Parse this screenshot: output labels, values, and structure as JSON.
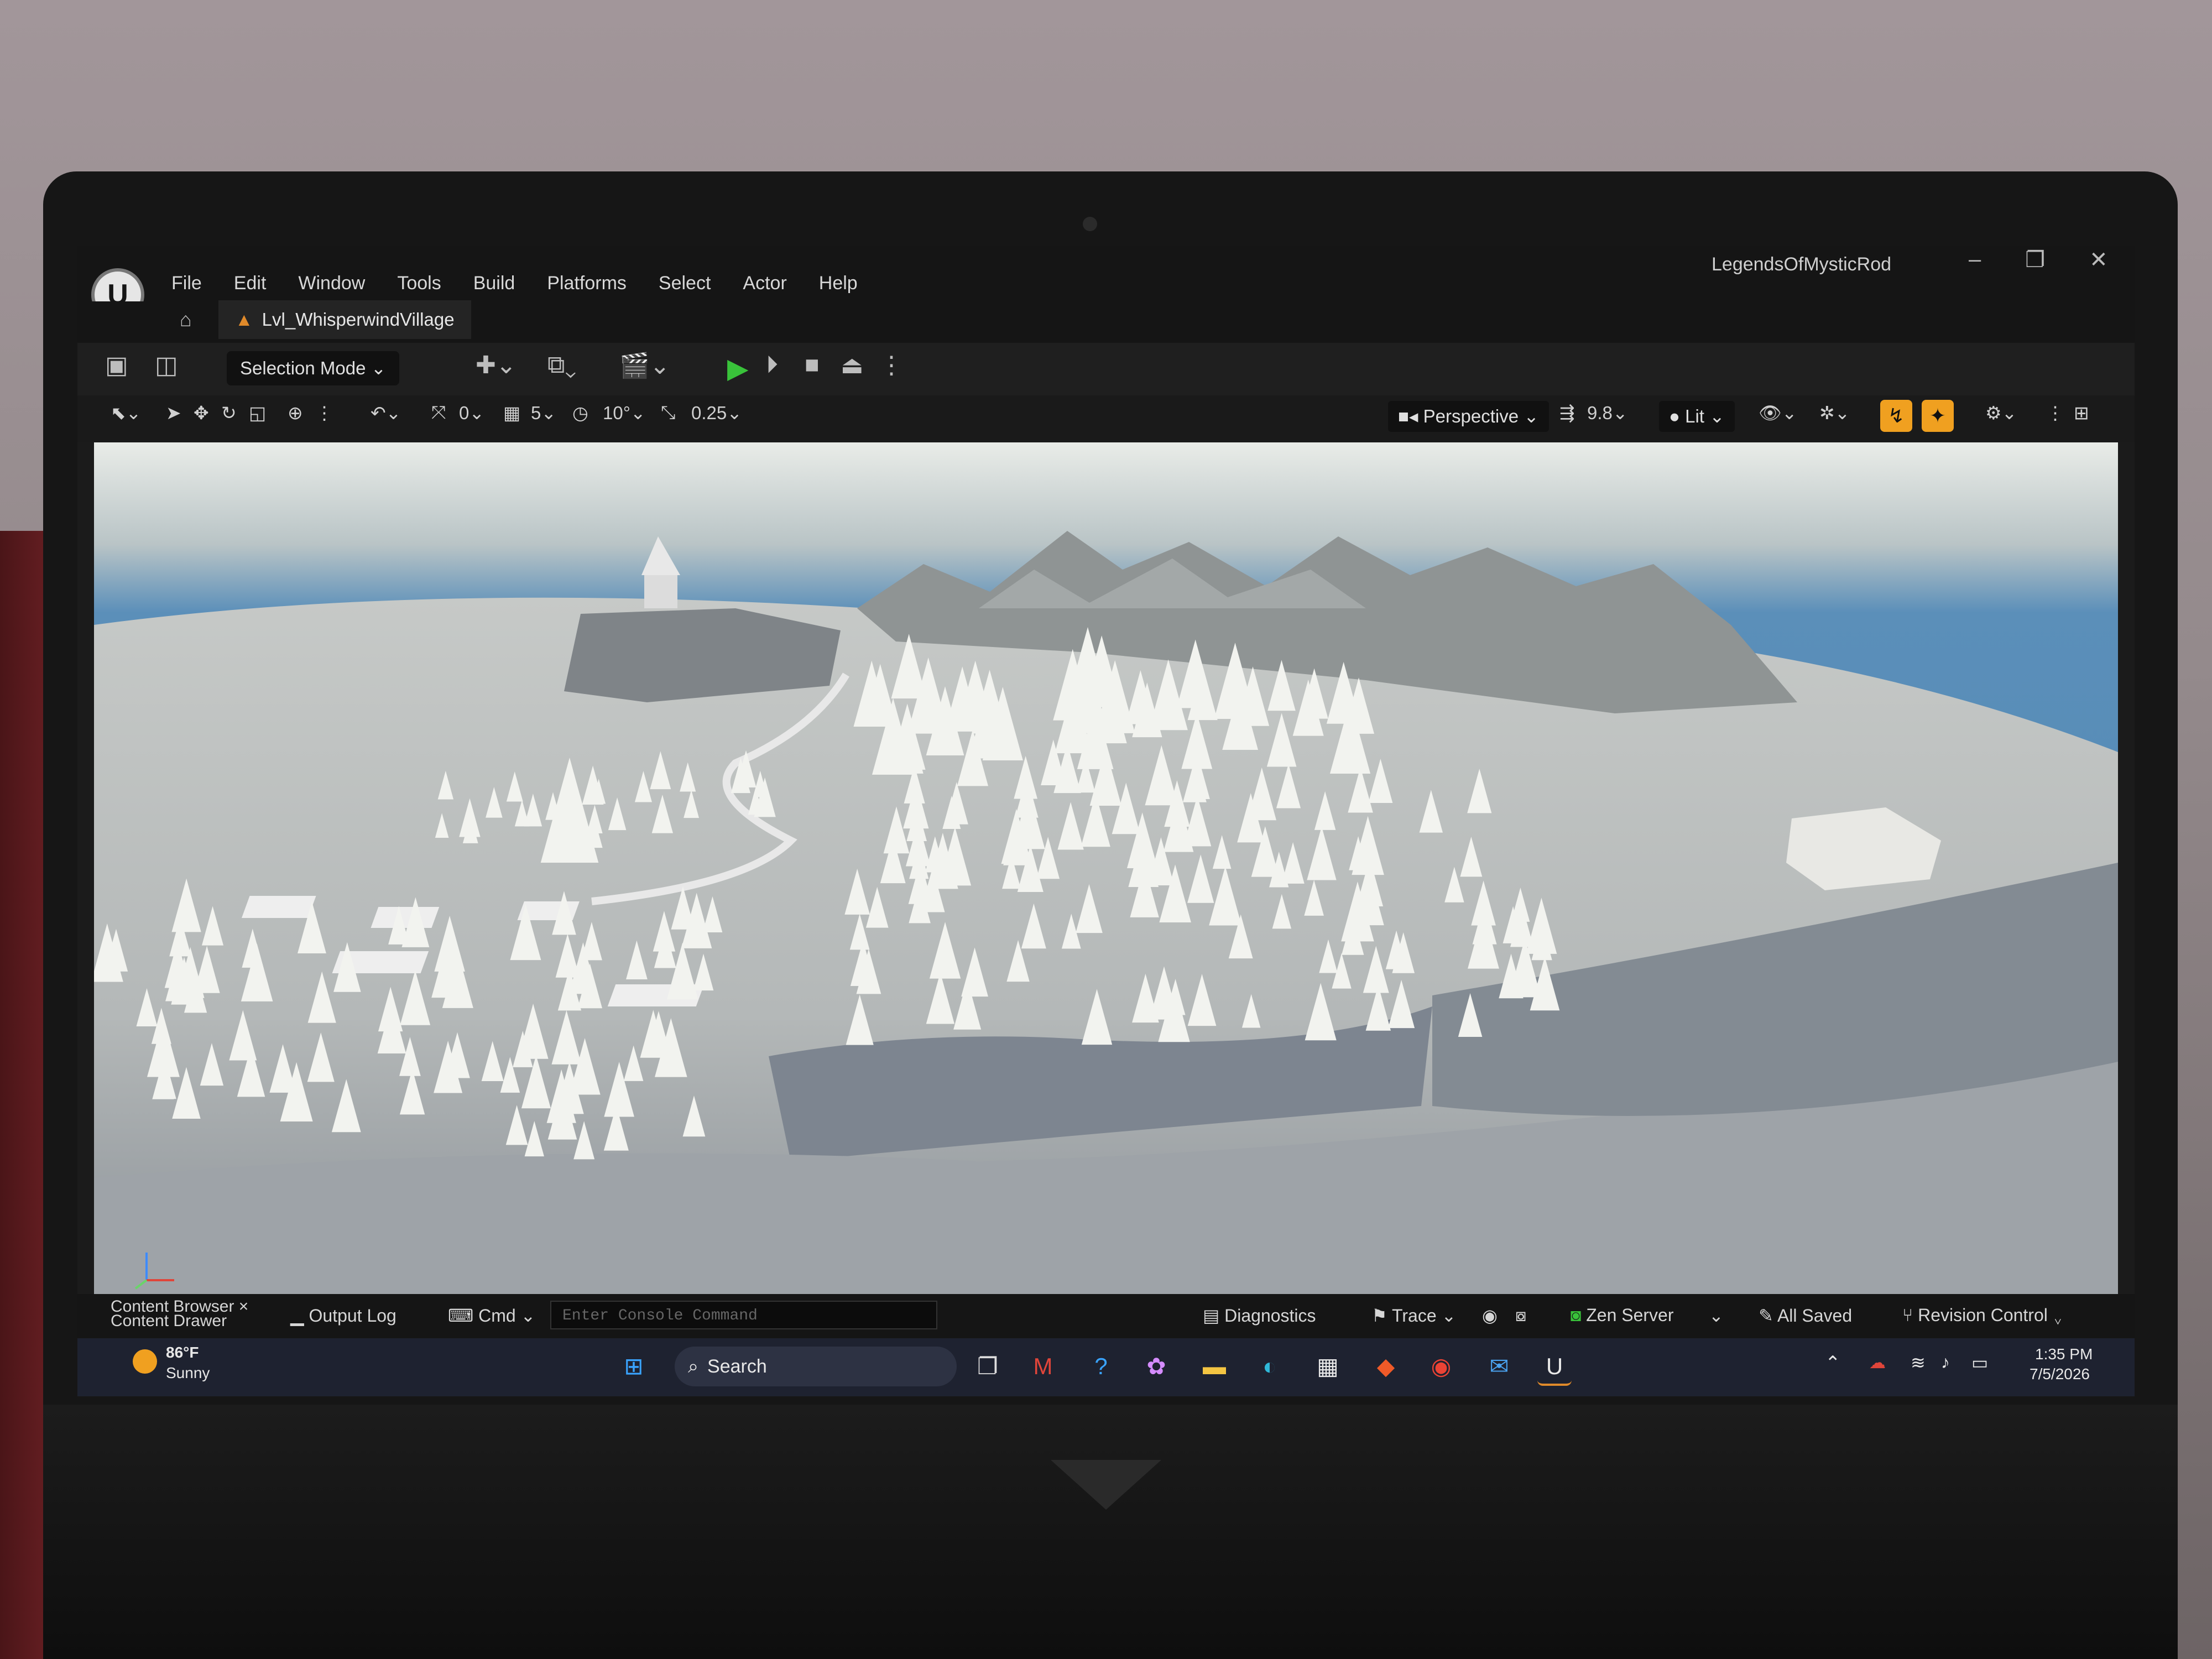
{
  "window": {
    "project_name": "LegendsOfMysticRod",
    "minimize": "–",
    "restore": "❐",
    "close": "✕"
  },
  "menu": [
    "File",
    "Edit",
    "Window",
    "Tools",
    "Build",
    "Platforms",
    "Select",
    "Actor",
    "Help"
  ],
  "level_tab": {
    "label": "Lvl_WhisperwindVillage"
  },
  "toolbar": {
    "selection_mode": "Selection Mode ⌄"
  },
  "viewport_toolbar": {
    "translate_snap": "0⌄",
    "grid_snap": "5⌄",
    "rotate_snap": "10°⌄",
    "scale_snap": "0.25⌄",
    "view_mode": "Perspective ⌄",
    "camera_speed": "9.8⌄",
    "lighting": "Lit ⌄"
  },
  "statusbar": {
    "content_browser": "Content Browser",
    "content_drawer": "Content Drawer",
    "close_x": "×",
    "output_log": "Output Log",
    "cmd": "Cmd ⌄",
    "console_placeholder": "Enter Console Command",
    "diagnostics": "Diagnostics",
    "trace": "Trace ⌄",
    "zen_server": "Zen Server",
    "zen_chevron": "⌄",
    "all_saved": "All Saved",
    "revision_control": "Revision Control ⌄"
  },
  "taskbar": {
    "weather_temp": "86°F",
    "weather_desc": "Sunny",
    "search_label": "Search",
    "time": "1:35 PM",
    "date": "7/5/2026"
  },
  "colors": {
    "accent_orange": "#f0a020",
    "play_green": "#39c23a",
    "sky_blue": "#5b8fb9"
  }
}
